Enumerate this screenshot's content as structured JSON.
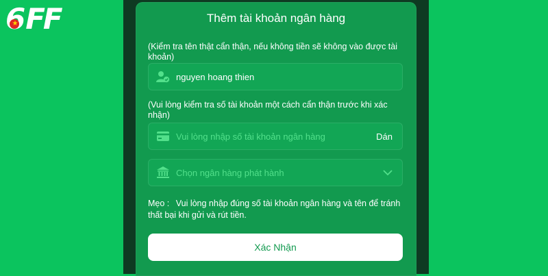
{
  "logo": {
    "digit": "6",
    "letters": "FF"
  },
  "dialog": {
    "title": "Thêm tài khoản ngân hàng",
    "name_note": "(Kiểm tra tên thật cẩn thận, nếu không tiền sẽ không vào được tài khoản)",
    "name_field": {
      "icon": "user-check-icon",
      "value": "nguyen hoang thien"
    },
    "account_note": "(Vui lòng kiểm tra số tài khoản một cách cẩn thận trước khi xác nhận)",
    "account_field": {
      "icon": "card-icon",
      "placeholder": "Vui lòng nhập số tài khoản ngân hàng",
      "paste_label": "Dán"
    },
    "bank_select": {
      "icon": "bank-icon",
      "placeholder": "Chọn ngân hàng phát hành",
      "chevron": "chevron-down-icon"
    },
    "tip_label": "Mẹo :",
    "tip_text": "Vui lòng nhập đúng số tài khoản ngân hàng và tên để tránh thất bại khi gửi và rút tiền.",
    "confirm_label": "Xác Nhận"
  },
  "colors": {
    "page_bg": "#0bc45e",
    "panel_bg": "#129a4f",
    "overlay": "#0e3a22",
    "accent_text": "#52e08b"
  }
}
